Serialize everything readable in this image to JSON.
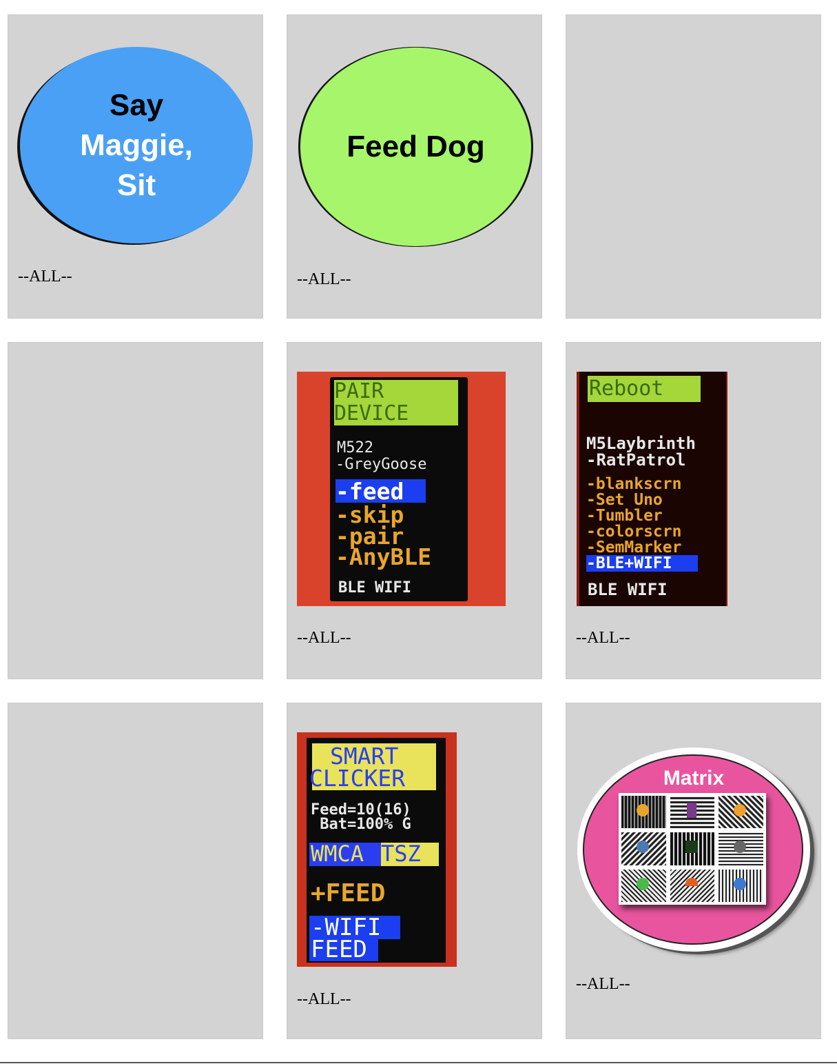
{
  "caption": "--ALL--",
  "cards": {
    "say_maggie_sit": {
      "lines": [
        "Say",
        "Maggie,",
        "Sit"
      ],
      "color": "#4aa0f5"
    },
    "feed_dog": {
      "label": "Feed Dog",
      "color": "#a6f56b"
    },
    "pair_device": {
      "header": [
        "PAIR",
        "DEVICE"
      ],
      "device": "M522",
      "item": "-GreyGoose",
      "menu": [
        "-feed",
        "-skip",
        "-pair",
        "-AnyBLE"
      ],
      "footer": "BLE WIFI"
    },
    "reboot": {
      "header": "Reboot",
      "device": "M5Laybrinth",
      "item": "-RatPatrol",
      "menu": [
        "-blankscrn",
        "-Set Uno",
        "-Tumbler",
        "-colorscrn",
        "-SemMarker",
        "-BLE+WIFI"
      ],
      "footer": "BLE WIFI"
    },
    "smart_clicker": {
      "header": [
        "SMART",
        "CLICKER"
      ],
      "status": [
        "Feed=10(16)",
        " Bat=100% G"
      ],
      "mode_a": "WMCA",
      "mode_b": "TSZ",
      "action": "+FEED",
      "option": [
        "-WIFI",
        "FEED"
      ]
    },
    "matrix": {
      "title": "Matrix",
      "color": "#e8559e"
    }
  }
}
